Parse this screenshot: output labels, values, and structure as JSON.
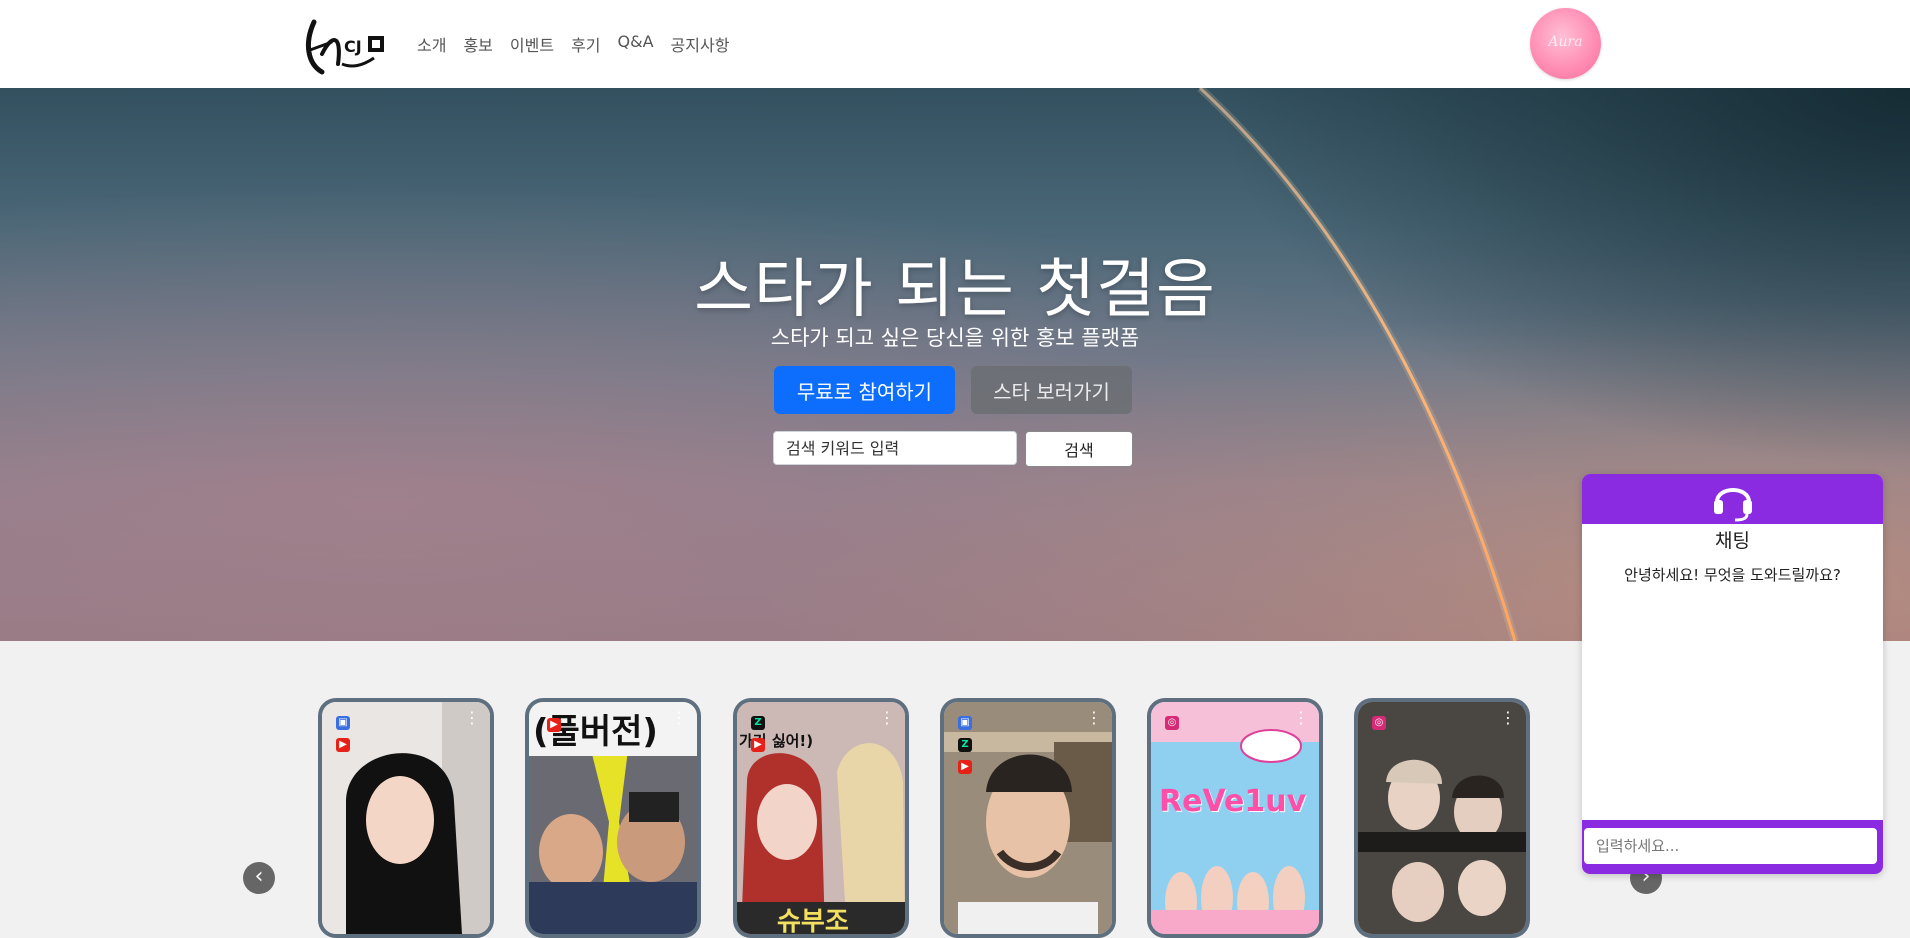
{
  "header": {
    "logo_alt": "스타",
    "nav": [
      "소개",
      "홍보",
      "이벤트",
      "후기",
      "Q&A",
      "공지사항"
    ],
    "profile_text": "Aura"
  },
  "hero": {
    "title": "스타가 되는 첫걸음",
    "subtitle": "스타가 되고 싶은 당신을 위한 홍보 플랫폼",
    "primary_button": "무료로 참여하기",
    "secondary_button": "스타 보러가기",
    "search_placeholder": "검색 키워드 입력",
    "search_button": "검색"
  },
  "carousel": {
    "cards": [
      {
        "platform_icons": [
          "tv-icon",
          "youtube-icon"
        ],
        "overlay_text": ""
      },
      {
        "platform_icons": [
          "youtube-icon"
        ],
        "overlay_text": "(풀버전)"
      },
      {
        "platform_icons": [
          "z-icon",
          "youtube-icon"
        ],
        "overlay_text": "가기 싫어!)"
      },
      {
        "platform_icons": [
          "tv-icon",
          "z-icon",
          "youtube-icon"
        ],
        "overlay_text": ""
      },
      {
        "platform_icons": [
          "instagram-icon"
        ],
        "overlay_text": "ReVe1uv"
      },
      {
        "platform_icons": [
          "instagram-icon"
        ],
        "overlay_text": ""
      }
    ],
    "prev_icon": "chevron-left-icon",
    "next_icon": "chevron-right-icon"
  },
  "chat": {
    "title": "채팅",
    "greeting": "안녕하세요! 무엇을 도와드릴까요?",
    "input_placeholder": "입력하세요...",
    "accent": "#8a2be2"
  },
  "colors": {
    "primary": "#0d6efd",
    "secondary": "#6c757d",
    "chat_accent": "#8a2be2"
  }
}
